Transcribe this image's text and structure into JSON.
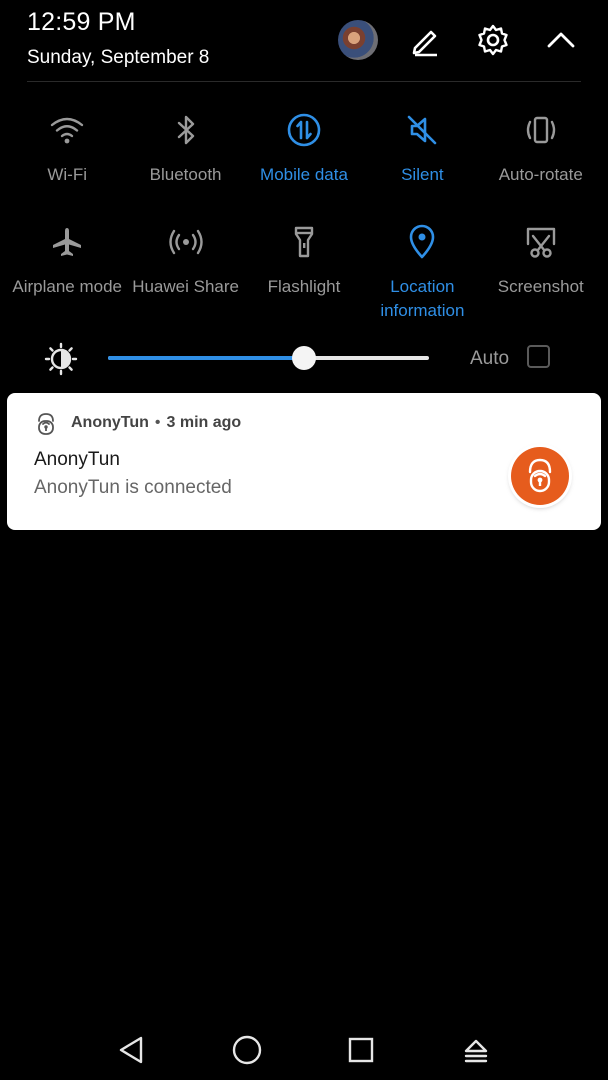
{
  "status": {
    "time": "12:59 PM",
    "date": "Sunday, September 8"
  },
  "header_icons": [
    "avatar",
    "edit-icon",
    "settings-gear-icon",
    "collapse-chevron-up-icon"
  ],
  "tiles_row1": [
    {
      "label": "Wi-Fi",
      "icon": "wifi-icon",
      "active": false
    },
    {
      "label": "Bluetooth",
      "icon": "bluetooth-icon",
      "active": false
    },
    {
      "label": "Mobile data",
      "icon": "mobile-data-icon",
      "active": true
    },
    {
      "label": "Silent",
      "icon": "silent-icon",
      "active": true
    },
    {
      "label": "Auto-rotate",
      "icon": "auto-rotate-icon",
      "active": false
    }
  ],
  "tiles_row2": [
    {
      "label": "Airplane mode",
      "icon": "airplane-icon",
      "active": false
    },
    {
      "label": "Huawei Share",
      "icon": "huawei-share-icon",
      "active": false
    },
    {
      "label": "Flashlight",
      "icon": "flashlight-icon",
      "active": false
    },
    {
      "label": "Location\ninformation",
      "icon": "location-icon",
      "active": true
    },
    {
      "label": "Screenshot",
      "icon": "screenshot-icon",
      "active": false
    }
  ],
  "brightness": {
    "level": 0.61,
    "auto_label": "Auto",
    "auto_checked": false
  },
  "notification": {
    "app": "AnonyTun",
    "separator": "•",
    "ago": "3 min ago",
    "title": "AnonyTun",
    "text": "AnonyTun is connected"
  },
  "colors": {
    "accent": "#2f8fe6",
    "inactive": "#9a9a9a",
    "notification_icon": "#e65c1d"
  },
  "navbar": [
    "back-icon",
    "home-icon",
    "recents-icon",
    "notification-dismiss-icon"
  ]
}
